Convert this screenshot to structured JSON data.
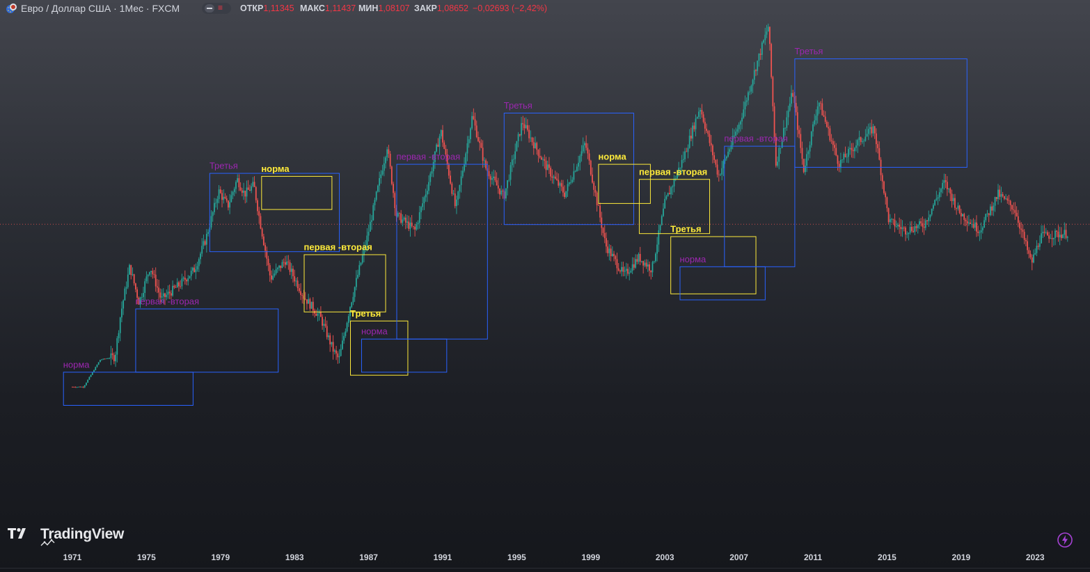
{
  "header": {
    "title": "Евро / Доллар США · 1Мес · FXCM",
    "icon": "euro-dollar-flag-icon",
    "pill_icons": [
      "minus-icon",
      "equals-icon"
    ],
    "open_label": "ОТКР",
    "open_value": "1,11345",
    "high_label": "МАКС",
    "high_value": "1,11437",
    "low_label": "МИН",
    "low_value": "1,08107",
    "close_label": "ЗАКР",
    "close_value": "1,08652",
    "change_value": "−0,02693 (−2,42%)"
  },
  "brand": {
    "name": "TradingView",
    "icon": "tradingview-logo-icon"
  },
  "bolt_icon": "lightning-icon",
  "colors": {
    "up": "#26a69a",
    "down": "#ef5350",
    "box_blue": "#2962ff",
    "box_yellow": "#ffeb3b",
    "label_purple": "#9c27b0",
    "label_yellow": "#ffeb3b",
    "price_line": "#ef5350",
    "negative": "#f23645"
  },
  "chart_data": {
    "type": "candlestick",
    "symbol": "Евро / Доллар США",
    "timeframe": "1Мес",
    "source": "FXCM",
    "x_tick_labels": [
      "1971",
      "1975",
      "1979",
      "1983",
      "1987",
      "1991",
      "1995",
      "1999",
      "2003",
      "2007",
      "2011",
      "2015",
      "2019",
      "2023"
    ],
    "x_range": [
      1971,
      2024.75
    ],
    "series_keypoints": [
      {
        "t": 1971.0,
        "v": 1.06
      },
      {
        "t": 1971.6,
        "v": 1.06
      },
      {
        "t": 1972.5,
        "v": 1.15
      },
      {
        "t": 1973.3,
        "v": 1.16
      },
      {
        "t": 1973.6,
        "v": 1.3
      },
      {
        "t": 1974.1,
        "v": 1.46
      },
      {
        "t": 1974.6,
        "v": 1.34
      },
      {
        "t": 1975.2,
        "v": 1.46
      },
      {
        "t": 1975.8,
        "v": 1.35
      },
      {
        "t": 1976.8,
        "v": 1.4
      },
      {
        "t": 1977.6,
        "v": 1.45
      },
      {
        "t": 1978.2,
        "v": 1.55
      },
      {
        "t": 1978.9,
        "v": 1.71
      },
      {
        "t": 1979.4,
        "v": 1.66
      },
      {
        "t": 1979.9,
        "v": 1.75
      },
      {
        "t": 1980.3,
        "v": 1.7
      },
      {
        "t": 1980.8,
        "v": 1.73
      },
      {
        "t": 1981.1,
        "v": 1.62
      },
      {
        "t": 1981.7,
        "v": 1.42
      },
      {
        "t": 1982.5,
        "v": 1.48
      },
      {
        "t": 1983.5,
        "v": 1.36
      },
      {
        "t": 1984.4,
        "v": 1.29
      },
      {
        "t": 1985.1,
        "v": 1.18
      },
      {
        "t": 1985.4,
        "v": 1.15
      },
      {
        "t": 1986.0,
        "v": 1.33
      },
      {
        "t": 1986.9,
        "v": 1.55
      },
      {
        "t": 1988.0,
        "v": 1.86
      },
      {
        "t": 1988.5,
        "v": 1.63
      },
      {
        "t": 1989.5,
        "v": 1.58
      },
      {
        "t": 1990.2,
        "v": 1.73
      },
      {
        "t": 1990.9,
        "v": 1.91
      },
      {
        "t": 1991.7,
        "v": 1.65
      },
      {
        "t": 1992.6,
        "v": 1.96
      },
      {
        "t": 1993.3,
        "v": 1.79
      },
      {
        "t": 1994.3,
        "v": 1.69
      },
      {
        "t": 1995.3,
        "v": 1.94
      },
      {
        "t": 1995.8,
        "v": 1.88
      },
      {
        "t": 1996.6,
        "v": 1.79
      },
      {
        "t": 1997.6,
        "v": 1.7
      },
      {
        "t": 1998.7,
        "v": 1.87
      },
      {
        "t": 1999.8,
        "v": 1.53
      },
      {
        "t": 2000.8,
        "v": 1.43
      },
      {
        "t": 2001.6,
        "v": 1.49
      },
      {
        "t": 2002.3,
        "v": 1.45
      },
      {
        "t": 2003.0,
        "v": 1.67
      },
      {
        "t": 2004.0,
        "v": 1.82
      },
      {
        "t": 2004.9,
        "v": 1.99
      },
      {
        "t": 2005.9,
        "v": 1.76
      },
      {
        "t": 2007.0,
        "v": 1.93
      },
      {
        "t": 2008.0,
        "v": 2.14
      },
      {
        "t": 2008.6,
        "v": 2.26
      },
      {
        "t": 2009.0,
        "v": 1.8
      },
      {
        "t": 2009.9,
        "v": 2.04
      },
      {
        "t": 2010.5,
        "v": 1.78
      },
      {
        "t": 2011.3,
        "v": 2.01
      },
      {
        "t": 2012.4,
        "v": 1.8
      },
      {
        "t": 2013.4,
        "v": 1.87
      },
      {
        "t": 2014.3,
        "v": 1.92
      },
      {
        "t": 2015.1,
        "v": 1.61
      },
      {
        "t": 2016.0,
        "v": 1.58
      },
      {
        "t": 2017.0,
        "v": 1.6
      },
      {
        "t": 2018.1,
        "v": 1.74
      },
      {
        "t": 2018.9,
        "v": 1.64
      },
      {
        "t": 2020.0,
        "v": 1.58
      },
      {
        "t": 2021.0,
        "v": 1.7
      },
      {
        "t": 2021.9,
        "v": 1.65
      },
      {
        "t": 2022.8,
        "v": 1.47
      },
      {
        "t": 2023.3,
        "v": 1.56
      },
      {
        "t": 2024.75,
        "v": 1.57
      }
    ],
    "current_price_level": 1.6,
    "annotations": [
      {
        "text": "норма",
        "style": "purple",
        "box_color": "blue",
        "t1": 1970.5,
        "t2": 1977.5,
        "v1": 1.0,
        "v2": 1.11
      },
      {
        "text": "первая -вторая",
        "style": "purple",
        "box_color": "blue",
        "t1": 1974.4,
        "t2": 1982.1,
        "v1": 1.11,
        "v2": 1.32
      },
      {
        "text": "Третья",
        "style": "purple",
        "box_color": "blue",
        "t1": 1978.4,
        "t2": 1985.4,
        "v1": 1.51,
        "v2": 1.77
      },
      {
        "text": "норма",
        "style": "yellow",
        "box_color": "yellow",
        "t1": 1981.2,
        "t2": 1985.0,
        "v1": 1.65,
        "v2": 1.76
      },
      {
        "text": "первая -вторая",
        "style": "yellow",
        "box_color": "yellow",
        "t1": 1983.5,
        "t2": 1987.9,
        "v1": 1.31,
        "v2": 1.5
      },
      {
        "text": "Третья",
        "style": "yellow",
        "box_color": "yellow",
        "t1": 1986.0,
        "t2": 1989.1,
        "v1": 1.1,
        "v2": 1.28
      },
      {
        "text": "норма",
        "style": "purple",
        "box_color": "blue",
        "t1": 1986.6,
        "t2": 1991.2,
        "v1": 1.11,
        "v2": 1.22
      },
      {
        "text": "первая -вторая",
        "style": "purple",
        "box_color": "blue",
        "t1": 1988.5,
        "t2": 1993.4,
        "v1": 1.22,
        "v2": 1.8
      },
      {
        "text": "Третья",
        "style": "purple",
        "box_color": "blue",
        "t1": 1994.3,
        "t2": 2001.3,
        "v1": 1.6,
        "v2": 1.97
      },
      {
        "text": "норма",
        "style": "yellow",
        "box_color": "yellow",
        "t1": 1999.4,
        "t2": 2002.2,
        "v1": 1.67,
        "v2": 1.8
      },
      {
        "text": "первая -вторая",
        "style": "yellow",
        "box_color": "yellow",
        "t1": 2001.6,
        "t2": 2005.4,
        "v1": 1.57,
        "v2": 1.75
      },
      {
        "text": "Третья",
        "style": "yellow",
        "box_color": "yellow",
        "t1": 2003.3,
        "t2": 2007.9,
        "v1": 1.37,
        "v2": 1.56
      },
      {
        "text": "норма",
        "style": "purple",
        "box_color": "blue",
        "t1": 2003.8,
        "t2": 2008.4,
        "v1": 1.35,
        "v2": 1.46
      },
      {
        "text": "первая -вторая",
        "style": "purple",
        "box_color": "blue",
        "t1": 2006.2,
        "t2": 2010.0,
        "v1": 1.46,
        "v2": 1.86
      },
      {
        "text": "Третья",
        "style": "purple",
        "box_color": "blue",
        "t1": 2010.0,
        "t2": 2019.3,
        "v1": 1.79,
        "v2": 2.15
      }
    ]
  }
}
